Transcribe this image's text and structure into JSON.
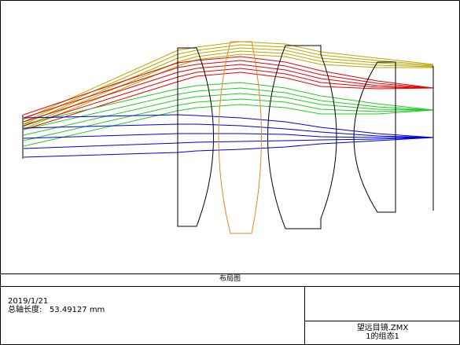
{
  "diagram": {
    "caption": "布局图",
    "date": "2019/1/21",
    "total_length_label": "总轴长度:",
    "total_length_value": "53.49127 mm",
    "file_name": "望远目镜.ZMX",
    "config_name": "1的组态1"
  },
  "colors": {
    "frame": "#000000",
    "lens": "#000000",
    "highlight_lens": "#e08a1e",
    "ray_yellow": "#b8a600",
    "ray_red": "#e80000",
    "ray_green": "#22cc22",
    "ray_blue": "#0000e0"
  }
}
